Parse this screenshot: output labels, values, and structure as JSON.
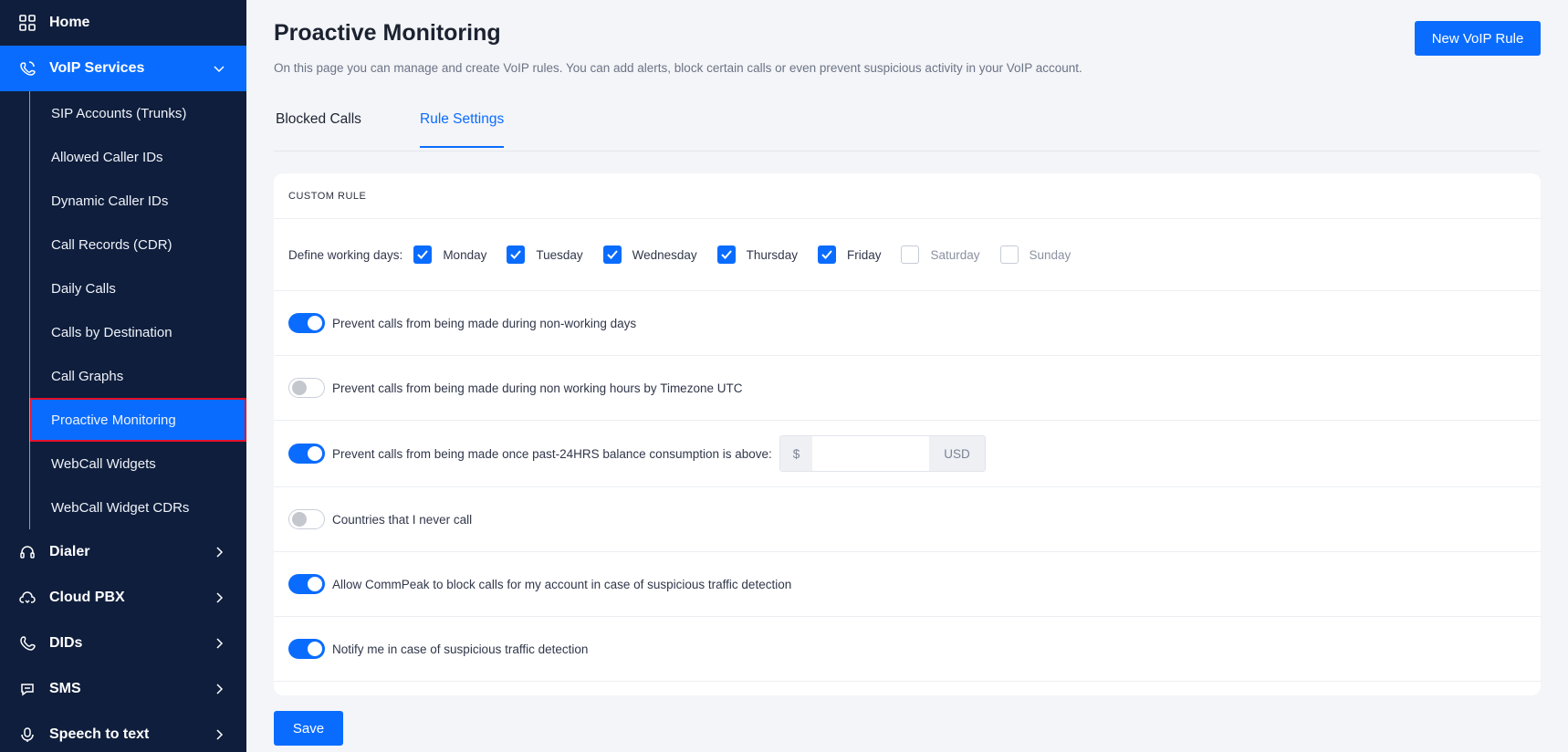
{
  "sidebar": {
    "home": "Home",
    "voip": "VoIP Services",
    "sub_items": [
      {
        "label": "SIP Accounts (Trunks)"
      },
      {
        "label": "Allowed Caller IDs"
      },
      {
        "label": "Dynamic Caller IDs"
      },
      {
        "label": "Call Records (CDR)"
      },
      {
        "label": "Daily Calls"
      },
      {
        "label": "Calls by Destination"
      },
      {
        "label": "Call Graphs"
      },
      {
        "label": "Proactive Monitoring"
      },
      {
        "label": "WebCall Widgets"
      },
      {
        "label": "WebCall Widget CDRs"
      }
    ],
    "groups": [
      {
        "label": "Dialer",
        "icon": "headset-icon"
      },
      {
        "label": "Cloud PBX",
        "icon": "cloud-phone-icon"
      },
      {
        "label": "DIDs",
        "icon": "phone-icon"
      },
      {
        "label": "SMS",
        "icon": "chat-icon"
      },
      {
        "label": "Speech to text",
        "icon": "microphone-icon"
      }
    ]
  },
  "header": {
    "title": "Proactive Monitoring",
    "description": "On this page you can manage and create VoIP rules. You can add alerts, block certain calls or even prevent suspicious activity in your VoIP account.",
    "new_rule_label": "New VoIP Rule"
  },
  "tabs": [
    {
      "label": "Blocked Calls",
      "active": false
    },
    {
      "label": "Rule Settings",
      "active": true
    }
  ],
  "card": {
    "header": "CUSTOM RULE",
    "days_label": "Define working days:",
    "days": [
      {
        "label": "Monday",
        "checked": true
      },
      {
        "label": "Tuesday",
        "checked": true
      },
      {
        "label": "Wednesday",
        "checked": true
      },
      {
        "label": "Thursday",
        "checked": true
      },
      {
        "label": "Friday",
        "checked": true
      },
      {
        "label": "Saturday",
        "checked": false
      },
      {
        "label": "Sunday",
        "checked": false
      }
    ],
    "rules": [
      {
        "label": "Prevent calls from being made during non-working days",
        "on": true
      },
      {
        "label": "Prevent calls from being made during non working hours by Timezone UTC",
        "on": false
      },
      {
        "label": "Prevent calls from being made once past-24HRS balance consumption is above:",
        "on": true
      },
      {
        "label": "Countries that I never call",
        "on": false
      },
      {
        "label": "Allow CommPeak to block calls for my account in case of suspicious traffic detection",
        "on": true
      },
      {
        "label": "Notify me in case of suspicious traffic detection",
        "on": true
      }
    ],
    "balance": {
      "prefix": "$",
      "value": "",
      "suffix": "USD"
    }
  },
  "save_label": "Save",
  "colors": {
    "accent": "#0a6cff",
    "sidebar": "#0f1e3c",
    "highlight_border": "#e3102a"
  }
}
